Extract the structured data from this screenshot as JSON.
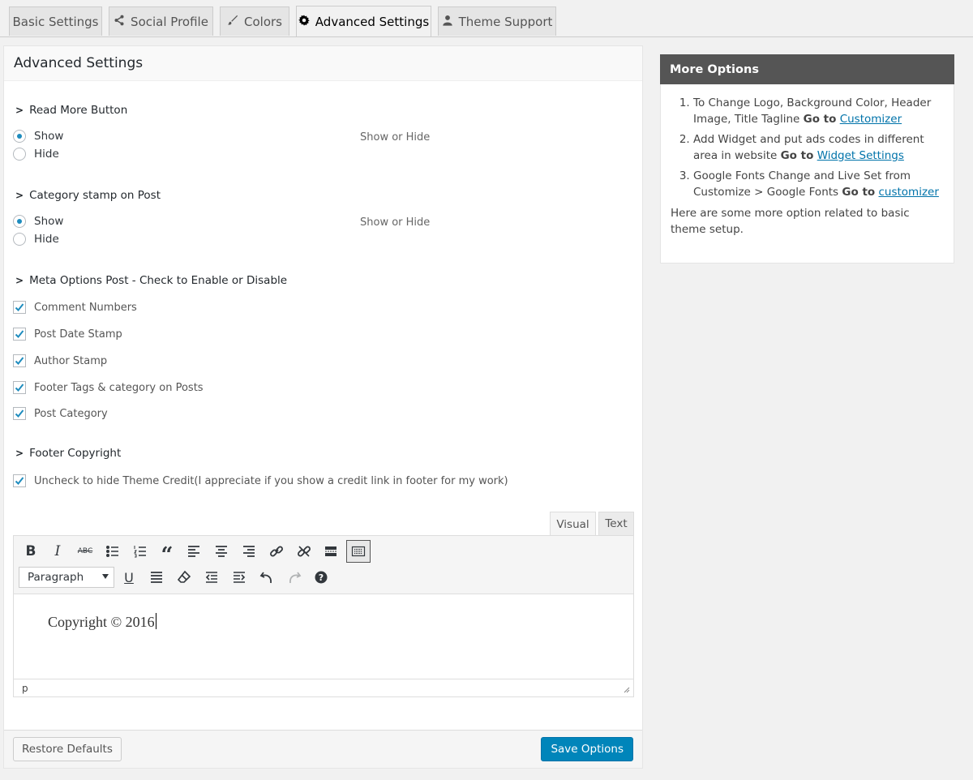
{
  "tabs": [
    {
      "label": "Basic Settings",
      "icon": null
    },
    {
      "label": "Social Profile",
      "icon": "share-icon"
    },
    {
      "label": "Colors",
      "icon": "brush-icon"
    },
    {
      "label": "Advanced Settings",
      "icon": "gear-icon"
    },
    {
      "label": "Theme Support",
      "icon": "user-icon"
    }
  ],
  "main": {
    "title": "Advanced Settings",
    "read_more": {
      "title": "Read More Button",
      "show": "Show",
      "hide": "Hide",
      "hint": "Show or Hide",
      "selected": "Show"
    },
    "category_stamp": {
      "title": "Category stamp on Post",
      "show": "Show",
      "hide": "Hide",
      "hint": "Show or Hide",
      "selected": "Show"
    },
    "meta": {
      "title": "Meta Options Post - Check to Enable or Disable",
      "items": [
        "Comment Numbers",
        "Post Date Stamp",
        "Author Stamp",
        "Footer Tags & category on Posts",
        "Post Category"
      ]
    },
    "footer_copyright": {
      "title": "Footer Copyright",
      "credit_label": "Uncheck to hide Theme Credit(I appreciate if you show a credit link in footer for my work)"
    },
    "editor": {
      "tab_visual": "Visual",
      "tab_text": "Text",
      "format_select": "Paragraph",
      "content": "Copyright © 2016",
      "path": "p"
    },
    "restore_label": "Restore Defaults",
    "save_label": "Save Options"
  },
  "sidebar": {
    "title": "More Options",
    "items": [
      {
        "text": "To Change Logo, Background Color, Header Image, Title Tagline",
        "go": "Go to",
        "link": "Customizer"
      },
      {
        "text": "Add Widget and put ads codes in different area in website",
        "go": "Go to",
        "link": "Widget Settings"
      },
      {
        "text": "Google Fonts Change and Live Set from Customize > Google Fonts",
        "go": "Go to",
        "link": "customizer"
      }
    ],
    "note": "Here are some more option related to basic theme setup."
  },
  "colors": {
    "primary": "#0085ba",
    "checkmark": "#1e8cbe",
    "sidebar_header": "#555555",
    "link": "#0073aa"
  }
}
